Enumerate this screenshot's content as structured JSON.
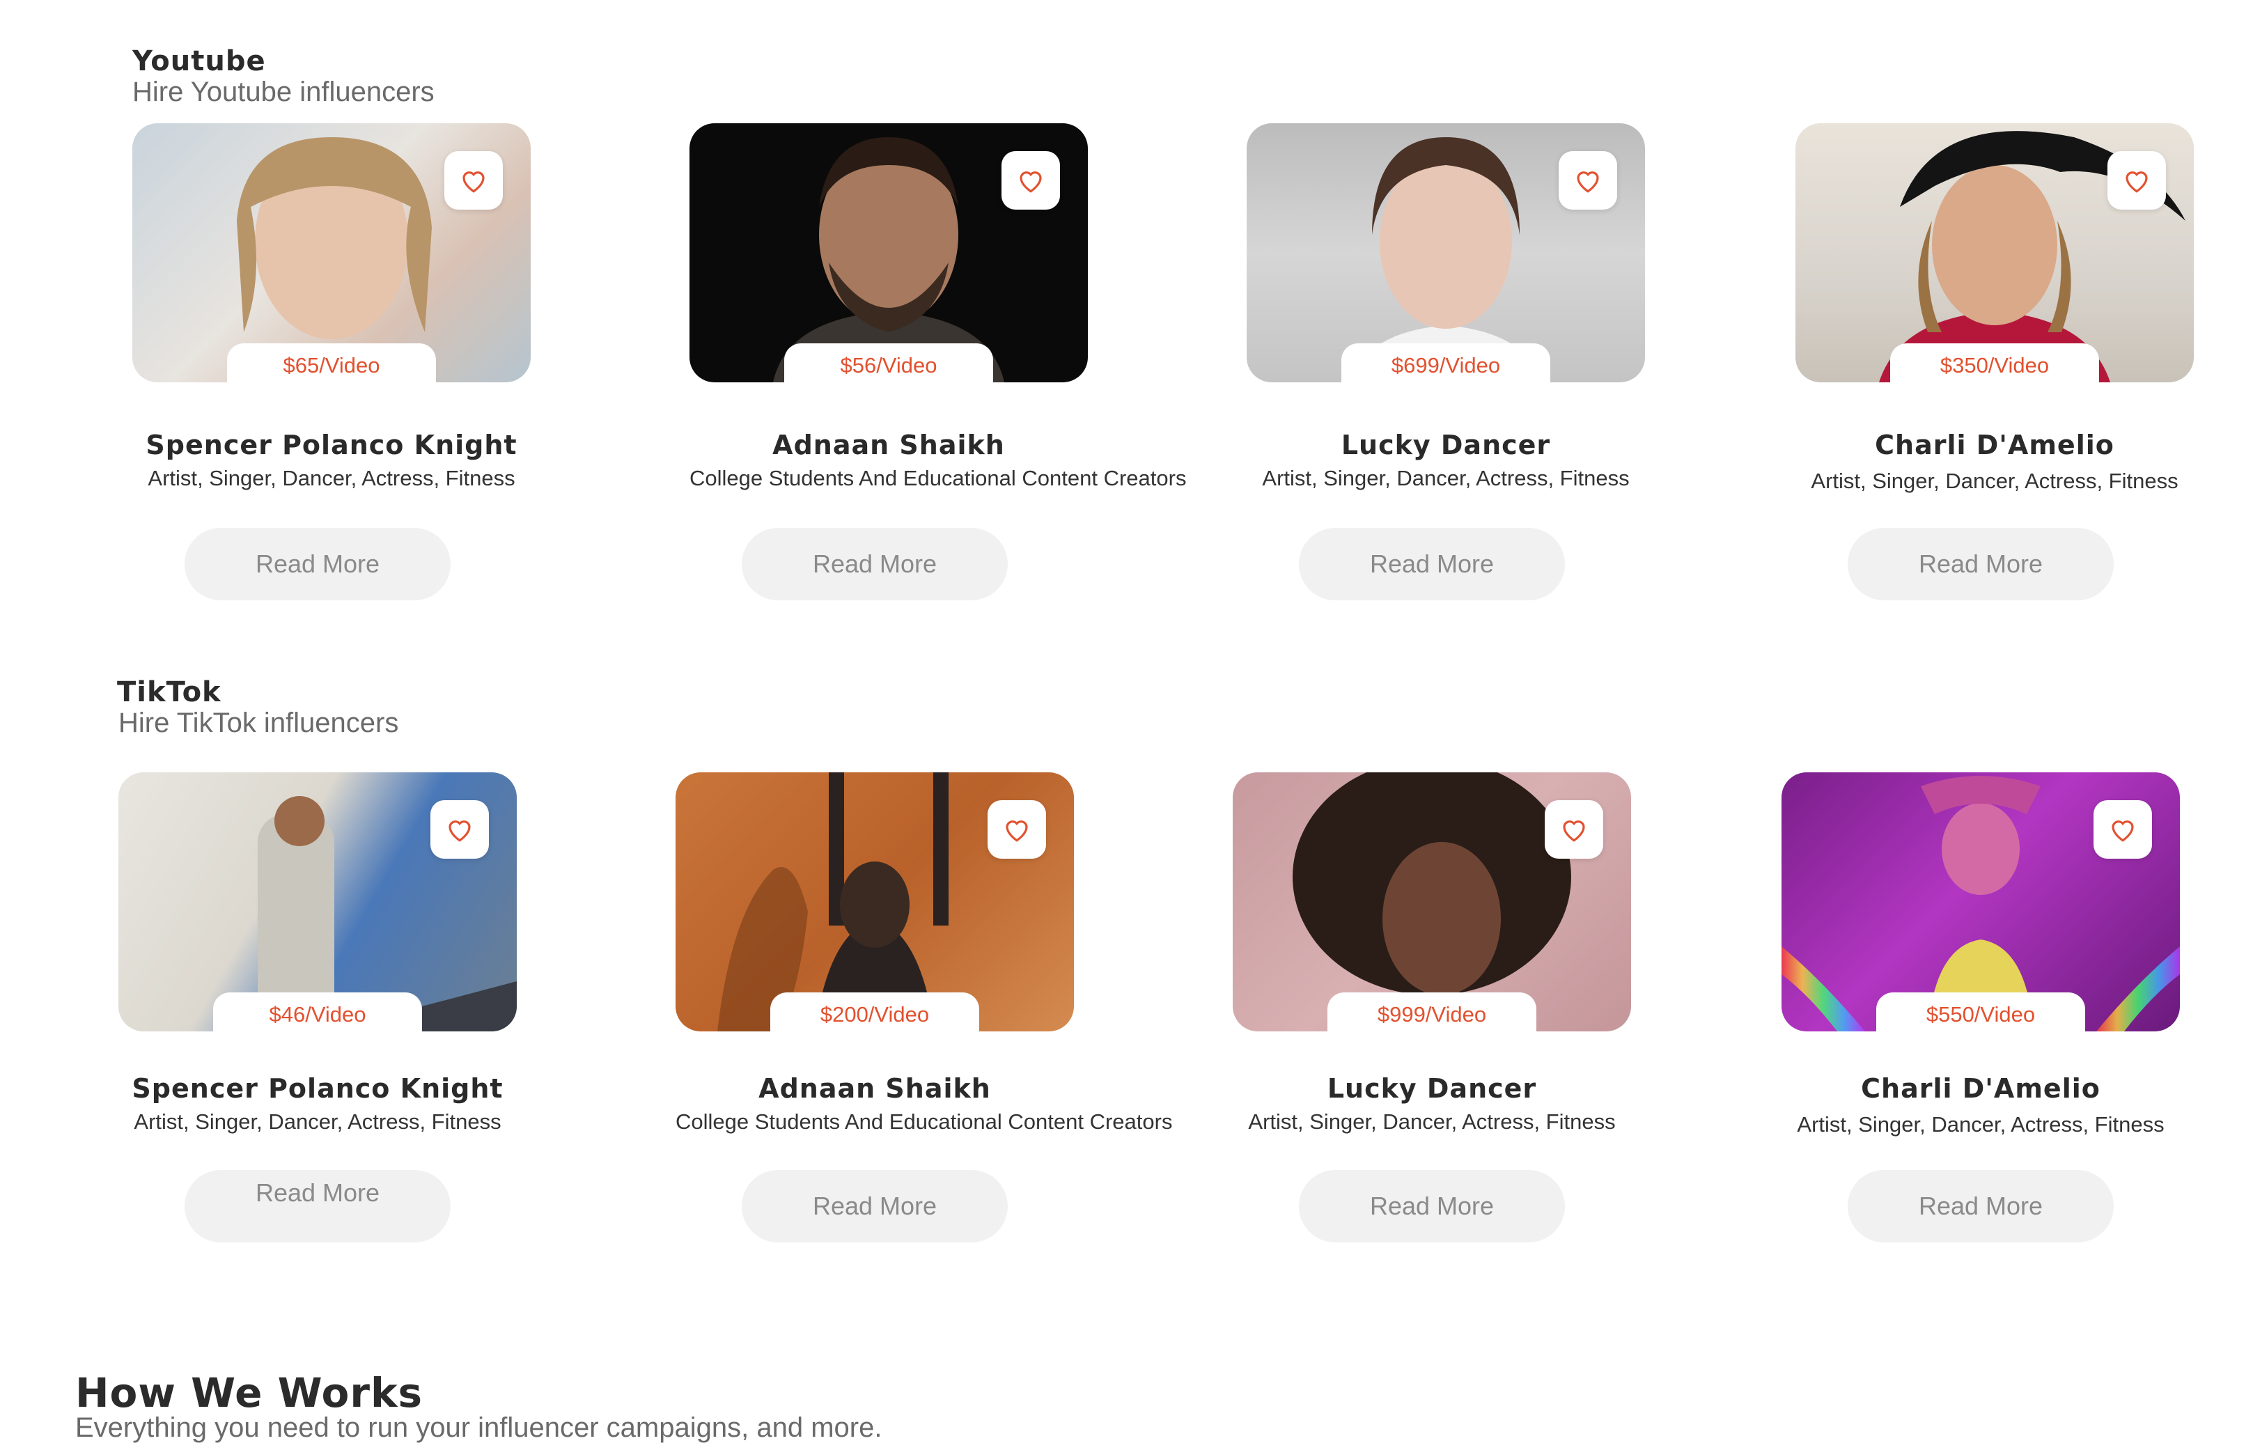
{
  "youtube": {
    "title": "Youtube",
    "subtitle": "Hire Youtube influencers",
    "cards": [
      {
        "price": "$65/Video",
        "name": "Spencer Polanco Knight",
        "category": "Artist, Singer, Dancer, Actress, Fitness",
        "button": "Read More"
      },
      {
        "price": "$56/Video",
        "name": "Adnaan Shaikh",
        "category": "College Students And Educational Content Creators",
        "button": "Read More"
      },
      {
        "price": "$699/Video",
        "name": "Lucky Dancer",
        "category": "Artist, Singer, Dancer, Actress, Fitness",
        "button": "Read More"
      },
      {
        "price": "$350/Video",
        "name": "Charli D'Amelio",
        "category": "Artist, Singer, Dancer, Actress, Fitness",
        "button": "Read More"
      }
    ]
  },
  "tiktok": {
    "title": "TikTok",
    "subtitle": "Hire TikTok influencers",
    "cards": [
      {
        "price": "$46/Video",
        "name": "Spencer Polanco Knight",
        "category": "Artist, Singer, Dancer, Actress, Fitness",
        "button": "Read More"
      },
      {
        "price": "$200/Video",
        "name": "Adnaan Shaikh",
        "category": "College Students And Educational Content Creators",
        "button": "Read More"
      },
      {
        "price": "$999/Video",
        "name": "Lucky Dancer",
        "category": "Artist, Singer, Dancer, Actress, Fitness",
        "button": "Read More"
      },
      {
        "price": "$550/Video",
        "name": "Charli D'Amelio",
        "category": "Artist, Singer, Dancer, Actress, Fitness",
        "button": "Read More"
      }
    ]
  },
  "how_we_works": {
    "title": "How We Works",
    "subtitle": "Everything you need to run your influencer campaigns, and more."
  },
  "colors": {
    "price": "#e2512f",
    "heart": "#e2512f",
    "button_bg": "#f1f1f1",
    "button_text": "#8a8a8a"
  },
  "icons": {
    "favorite": "heart-icon"
  }
}
